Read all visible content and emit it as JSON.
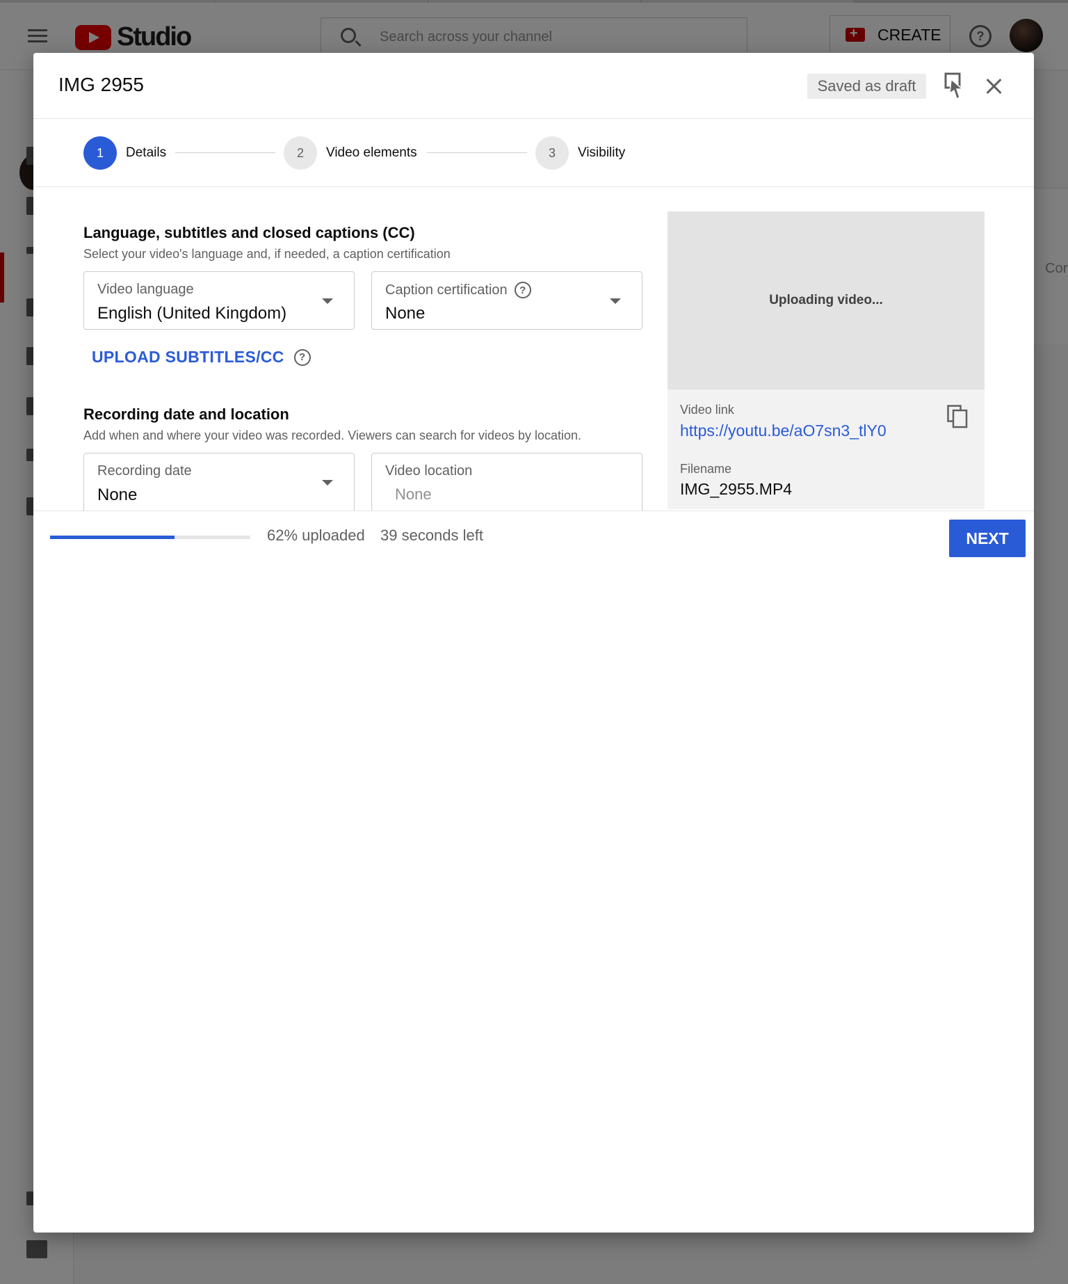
{
  "header": {
    "logo_text": "Studio",
    "search_placeholder": "Search across your channel",
    "create_label": "CREATE",
    "help_glyph": "?"
  },
  "background": {
    "right_clipped_text": "Cor"
  },
  "dialog": {
    "title": "IMG 2955",
    "draft_status": "Saved as draft",
    "steps": [
      {
        "number": "1",
        "label": "Details",
        "active": true
      },
      {
        "number": "2",
        "label": "Video elements",
        "active": false
      },
      {
        "number": "3",
        "label": "Visibility",
        "active": false
      }
    ],
    "language_section": {
      "title": "Language, subtitles and closed captions (CC)",
      "description": "Select your video's language and, if needed, a caption certification",
      "video_language": {
        "label": "Video language",
        "value": "English (United Kingdom)"
      },
      "caption_certification": {
        "label": "Caption certification",
        "value": "None"
      },
      "upload_subtitles_label": "UPLOAD SUBTITLES/CC"
    },
    "recording_section": {
      "title": "Recording date and location",
      "description": "Add when and where your video was recorded. Viewers can search for videos by location.",
      "recording_date": {
        "label": "Recording date",
        "value": "None"
      },
      "video_location": {
        "label": "Video location",
        "placeholder": "None"
      }
    },
    "preview": {
      "status": "Uploading video...",
      "video_link_label": "Video link",
      "video_link": "https://youtu.be/aO7sn3_tlY0",
      "filename_label": "Filename",
      "filename": "IMG_2955.MP4"
    },
    "footer": {
      "progress_percent": 62,
      "progress_text": "62% uploaded",
      "time_left": "39 seconds left",
      "next_label": "NEXT"
    }
  },
  "colors": {
    "accent": "#2a5bd7",
    "brand_red": "#ff0000"
  },
  "icons": {
    "menu": "hamburger-icon",
    "search": "search-icon",
    "create": "video-camera-icon",
    "help": "help-icon",
    "feedback": "feedback-icon",
    "close": "close-icon",
    "copy": "copy-icon",
    "dropdown": "chevron-down-icon"
  }
}
